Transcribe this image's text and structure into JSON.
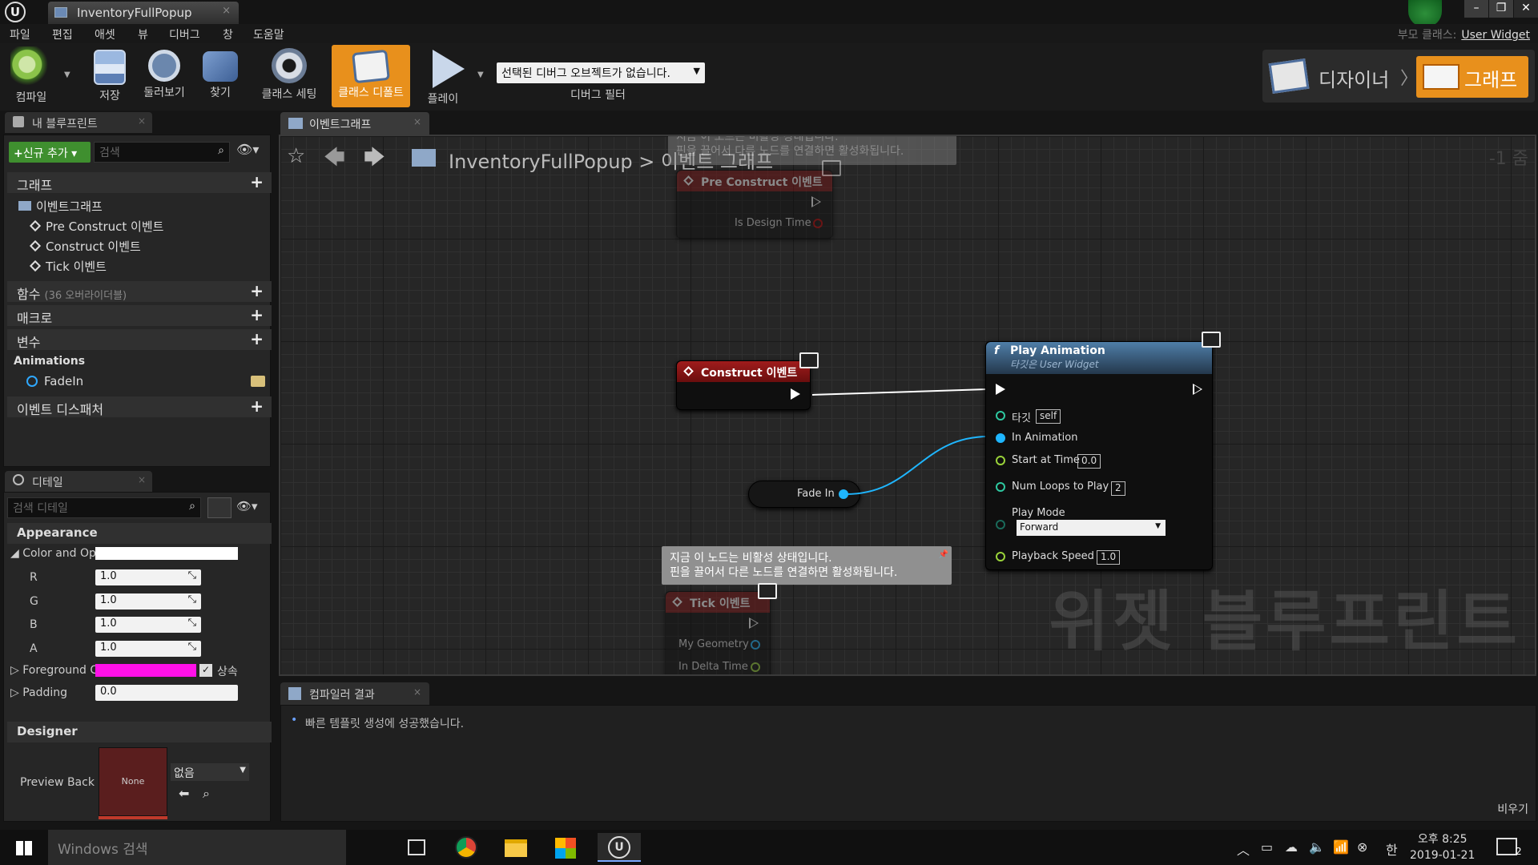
{
  "window": {
    "tab_title": "InventoryFullPopup",
    "tab_close": "×",
    "logo": "U",
    "controls": [
      "–",
      "❐",
      "✕"
    ]
  },
  "menu": {
    "items": [
      "파일",
      "편집",
      "애셋",
      "뷰",
      "디버그",
      "창",
      "도움말"
    ],
    "parent_class_label": "부모 클래스:",
    "parent_class_value": "User Widget"
  },
  "toolbar": {
    "buttons": [
      {
        "label": "컴파일",
        "icon": "compile-gear-icon"
      },
      {
        "label": "저장",
        "icon": "save-icon"
      },
      {
        "label": "둘러보기",
        "icon": "browse-icon"
      },
      {
        "label": "찾기",
        "icon": "find-icon"
      },
      {
        "label": "클래스 세팅",
        "icon": "class-settings-icon"
      },
      {
        "label": "클래스 디폴트",
        "icon": "class-defaults-icon"
      },
      {
        "label": "플레이",
        "icon": "play-icon"
      }
    ],
    "debug_select": "선택된 디버그 오브젝트가 없습니다.",
    "debug_filter": "디버그 필터",
    "mode_designer": "디자이너",
    "mode_graph": "그래프",
    "mode_separator": "〉"
  },
  "my_blueprint": {
    "tab": "내 블루프린트",
    "add_new": "신규 추가",
    "search_placeholder": "검색",
    "sections": {
      "graphs": "그래프",
      "functions": "함수",
      "functions_note": "(36 오버라이더블)",
      "macros": "매크로",
      "variables": "변수",
      "dispatchers": "이벤트 디스패처"
    },
    "event_graph": "이벤트그래프",
    "events": [
      "Pre Construct 이벤트",
      "Construct 이벤트",
      "Tick 이벤트"
    ],
    "var_category": "Animations",
    "var_item": "FadeIn"
  },
  "details": {
    "tab": "디테일",
    "search_placeholder": "검색 디테일",
    "appearance": "Appearance",
    "color_label": "Color and Opa",
    "channels": [
      {
        "label": "R",
        "value": "1.0"
      },
      {
        "label": "G",
        "value": "1.0"
      },
      {
        "label": "B",
        "value": "1.0"
      },
      {
        "label": "A",
        "value": "1.0"
      }
    ],
    "foreground_label": "Foreground C",
    "inherit_label": "상속",
    "padding_label": "Padding",
    "padding_value": "0.0",
    "designer": "Designer",
    "preview_label": "Preview Back",
    "preview_swatch": "None",
    "preview_select": "없음",
    "colors": {
      "foreground": "#ff10e8",
      "swatch": "#5a1e1e"
    }
  },
  "graph": {
    "tab": "이벤트그래프",
    "breadcrumb_asset": "InventoryFullPopup",
    "breadcrumb_sep": ">",
    "breadcrumb_graph": "이벤트 그래프",
    "zoom": "-1 줌",
    "watermark": "위젯 블루프린트",
    "top_comment_line1": "지금 이 노드는 비활성 상태입니다.",
    "top_comment_line2": "핀을 끌어서 다른 노드를 연결하면 활성화됩니다.",
    "pre_construct": {
      "title": "Pre Construct 이벤트",
      "pin": "Is Design Time"
    },
    "construct": {
      "title": "Construct 이벤트"
    },
    "fade_in": "Fade In",
    "comment_line1": "지금 이 노드는 비활성 상태입니다.",
    "comment_line2": "핀을 끌어서 다른 노드를 연결하면 활성화됩니다.",
    "tick": {
      "title": "Tick 이벤트",
      "pins": [
        "My Geometry",
        "In Delta Time"
      ]
    },
    "play_animation": {
      "title": "Play Animation",
      "subtitle": "타깃은 User Widget",
      "target_label": "타깃",
      "target_value": "self",
      "in_animation": "In Animation",
      "start_at_label": "Start at Time",
      "start_at_value": "0.0",
      "loops_label": "Num Loops to Play",
      "loops_value": "2",
      "mode_label": "Play Mode",
      "mode_value": "Forward",
      "speed_label": "Playback Speed",
      "speed_value": "1.0"
    }
  },
  "compiler": {
    "tab": "컴파일러 결과",
    "message": "빠른 템플릿 생성에 성공했습니다.",
    "clear": "비우기"
  },
  "taskbar": {
    "search": "Windows 검색",
    "time": "오후 8:25",
    "date": "2019-01-21",
    "ime": "한",
    "notif_count": "2"
  }
}
